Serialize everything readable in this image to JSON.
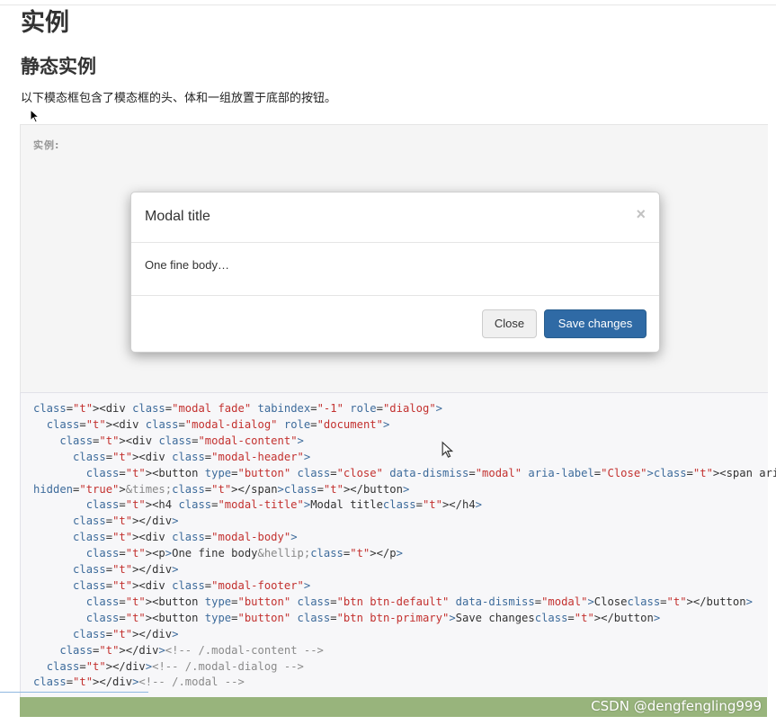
{
  "page": {
    "title": "实例",
    "section_title": "静态实例",
    "description": "以下模态框包含了模态框的头、体和一组放置于底部的按钮。"
  },
  "example": {
    "label": "实例:",
    "modal": {
      "title": "Modal title",
      "close_icon": "×",
      "body": "One fine body…",
      "close_button": "Close",
      "save_button": "Save changes"
    }
  },
  "code_lines": [
    "<div class=\"modal fade\" tabindex=\"-1\" role=\"dialog\">",
    "  <div class=\"modal-dialog\" role=\"document\">",
    "    <div class=\"modal-content\">",
    "      <div class=\"modal-header\">",
    "        <button type=\"button\" class=\"close\" data-dismiss=\"modal\" aria-label=\"Close\"><span aria-",
    "hidden=\"true\">&times;</span></button>",
    "        <h4 class=\"modal-title\">Modal title</h4>",
    "      </div>",
    "      <div class=\"modal-body\">",
    "        <p>One fine body&hellip;</p>",
    "      </div>",
    "      <div class=\"modal-footer\">",
    "        <button type=\"button\" class=\"btn btn-default\" data-dismiss=\"modal\">Close</button>",
    "        <button type=\"button\" class=\"btn btn-primary\">Save changes</button>",
    "      </div>",
    "    </div><!-- /.modal-content -->",
    "  </div><!-- /.modal-dialog -->",
    "</div><!-- /.modal -->"
  ],
  "watermark": "CSDN @dengfengling999",
  "colors": {
    "primary_button": "#2f6aa5",
    "footer_bar": "#98b47c",
    "code_tag": "#3d6b9b",
    "code_value": "#c3312f"
  },
  "icons": [
    "close-icon",
    "mouse-pointer-icon"
  ]
}
